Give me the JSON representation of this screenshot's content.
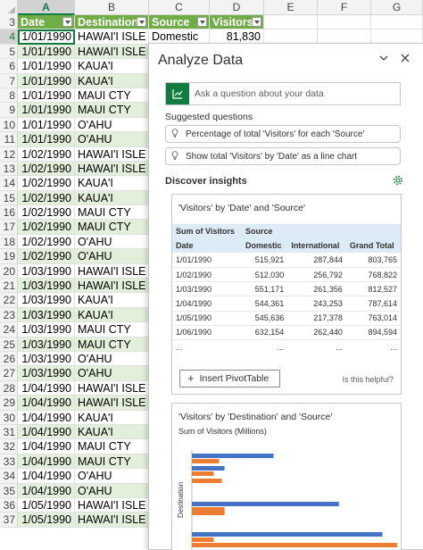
{
  "sheet": {
    "columns": [
      "A",
      "B",
      "C",
      "D",
      "E",
      "F",
      "G"
    ],
    "active_column": "A",
    "headers": [
      "Date",
      "Destination",
      "Source",
      "Visitors"
    ],
    "rows": [
      {
        "n": "3",
        "a": "",
        "b": "",
        "c": "",
        "d": "",
        "hdr": true
      },
      {
        "n": "4",
        "a": "1/01/1990",
        "b": "HAWAI'I ISLE",
        "c": "Domestic",
        "d": "81,830"
      },
      {
        "n": "5",
        "a": "1/01/1990",
        "b": "HAWAI'I ISLE",
        "c": "",
        "d": ""
      },
      {
        "n": "6",
        "a": "1/01/1990",
        "b": "KAUA'I",
        "c": "",
        "d": ""
      },
      {
        "n": "7",
        "a": "1/01/1990",
        "b": "KAUA'I",
        "c": "",
        "d": ""
      },
      {
        "n": "8",
        "a": "1/01/1990",
        "b": "MAUI CTY",
        "c": "",
        "d": ""
      },
      {
        "n": "9",
        "a": "1/01/1990",
        "b": "MAUI CTY",
        "c": "",
        "d": ""
      },
      {
        "n": "10",
        "a": "1/01/1990",
        "b": "O'AHU",
        "c": "",
        "d": ""
      },
      {
        "n": "11",
        "a": "1/01/1990",
        "b": "O'AHU",
        "c": "",
        "d": ""
      },
      {
        "n": "12",
        "a": "1/02/1990",
        "b": "HAWAI'I ISLE",
        "c": "",
        "d": ""
      },
      {
        "n": "13",
        "a": "1/02/1990",
        "b": "HAWAI'I ISLE",
        "c": "",
        "d": ""
      },
      {
        "n": "14",
        "a": "1/02/1990",
        "b": "KAUA'I",
        "c": "",
        "d": ""
      },
      {
        "n": "15",
        "a": "1/02/1990",
        "b": "KAUA'I",
        "c": "",
        "d": ""
      },
      {
        "n": "16",
        "a": "1/02/1990",
        "b": "MAUI CTY",
        "c": "",
        "d": ""
      },
      {
        "n": "17",
        "a": "1/02/1990",
        "b": "MAUI CTY",
        "c": "",
        "d": ""
      },
      {
        "n": "18",
        "a": "1/02/1990",
        "b": "O'AHU",
        "c": "",
        "d": ""
      },
      {
        "n": "19",
        "a": "1/02/1990",
        "b": "O'AHU",
        "c": "",
        "d": ""
      },
      {
        "n": "20",
        "a": "1/03/1990",
        "b": "HAWAI'I ISLE",
        "c": "",
        "d": ""
      },
      {
        "n": "21",
        "a": "1/03/1990",
        "b": "HAWAI'I ISLE",
        "c": "",
        "d": ""
      },
      {
        "n": "22",
        "a": "1/03/1990",
        "b": "KAUA'I",
        "c": "",
        "d": ""
      },
      {
        "n": "23",
        "a": "1/03/1990",
        "b": "KAUA'I",
        "c": "",
        "d": ""
      },
      {
        "n": "24",
        "a": "1/03/1990",
        "b": "MAUI CTY",
        "c": "",
        "d": ""
      },
      {
        "n": "25",
        "a": "1/03/1990",
        "b": "MAUI CTY",
        "c": "",
        "d": ""
      },
      {
        "n": "26",
        "a": "1/03/1990",
        "b": "O'AHU",
        "c": "",
        "d": ""
      },
      {
        "n": "27",
        "a": "1/03/1990",
        "b": "O'AHU",
        "c": "",
        "d": ""
      },
      {
        "n": "28",
        "a": "1/04/1990",
        "b": "HAWAI'I ISLE",
        "c": "",
        "d": ""
      },
      {
        "n": "29",
        "a": "1/04/1990",
        "b": "HAWAI'I ISLE",
        "c": "",
        "d": ""
      },
      {
        "n": "30",
        "a": "1/04/1990",
        "b": "KAUA'I",
        "c": "",
        "d": ""
      },
      {
        "n": "31",
        "a": "1/04/1990",
        "b": "KAUA'I",
        "c": "",
        "d": ""
      },
      {
        "n": "32",
        "a": "1/04/1990",
        "b": "MAUI CTY",
        "c": "",
        "d": ""
      },
      {
        "n": "33",
        "a": "1/04/1990",
        "b": "MAUI CTY",
        "c": "",
        "d": ""
      },
      {
        "n": "34",
        "a": "1/04/1990",
        "b": "O'AHU",
        "c": "",
        "d": ""
      },
      {
        "n": "35",
        "a": "1/04/1990",
        "b": "O'AHU",
        "c": "",
        "d": ""
      },
      {
        "n": "36",
        "a": "1/05/1990",
        "b": "HAWAI'I ISLE",
        "c": "",
        "d": ""
      },
      {
        "n": "37",
        "a": "1/05/1990",
        "b": "HAWAI'I ISLE",
        "c": "",
        "d": ""
      }
    ]
  },
  "pane": {
    "title": "Analyze Data",
    "ask_placeholder": "Ask a question about your data",
    "suggested_title": "Suggested questions",
    "suggestions": [
      "Percentage of total 'Visitors' for each 'Source'",
      "Show total 'Visitors' by 'Date' as a line chart"
    ],
    "discover_title": "Discover insights",
    "card1": {
      "title": "'Visitors' by 'Date' and 'Source'",
      "h1": [
        "Sum of Visitors",
        "Source",
        "",
        ""
      ],
      "h2": [
        "Date",
        "Domestic",
        "International",
        "Grand Total"
      ],
      "rows": [
        [
          "1/01/1990",
          "515,921",
          "287,844",
          "803,765"
        ],
        [
          "1/02/1990",
          "512,030",
          "256,792",
          "768,822"
        ],
        [
          "1/03/1990",
          "551,171",
          "261,356",
          "812,527"
        ],
        [
          "1/04/1990",
          "544,361",
          "243,253",
          "787,614"
        ],
        [
          "1/05/1990",
          "545,636",
          "217,378",
          "763,014"
        ],
        [
          "1/06/1990",
          "632,154",
          "262,440",
          "894,594"
        ]
      ],
      "ellipsis": [
        "...",
        "...",
        "...",
        "..."
      ],
      "insert_label": "Insert PivotTable",
      "helpful": "Is this helpful?"
    },
    "card2": {
      "title": "'Visitors' by 'Destination' and 'Source'",
      "subtitle": "Sum of Visitors (Millions)",
      "ylabel": "Destination"
    }
  },
  "chart_data": {
    "type": "bar",
    "title": "'Visitors' by 'Destination' and 'Source'",
    "subtitle": "Sum of Visitors (Millions)",
    "ylabel": "Destination",
    "series": [
      {
        "name": "",
        "color": "#4472c4",
        "values": [
          15,
          6,
          27,
          35
        ]
      },
      {
        "name": "",
        "color": "#ed7d31",
        "values": [
          5,
          4,
          6,
          4
        ]
      }
    ],
    "extra_orange": [
      5.5,
      12,
      1
    ],
    "colors": {
      "blue": "#4472c4",
      "orange": "#ed7d31"
    }
  }
}
